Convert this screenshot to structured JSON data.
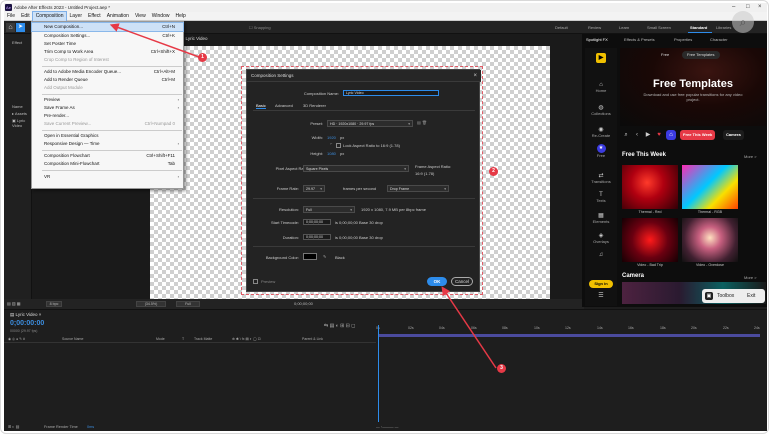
{
  "window": {
    "title": "Adobe After Effects 2023 - Untitled Project.aep *",
    "menus": [
      "File",
      "Edit",
      "Composition",
      "Layer",
      "Effect",
      "Animation",
      "View",
      "Window",
      "Help"
    ],
    "active_menu": "Composition"
  },
  "toolbar": {
    "snapping": "Snapping",
    "workspaces": [
      "Default",
      "Review",
      "Learn",
      "Small Screen",
      "Standard",
      "Libraries"
    ],
    "active_workspace": "Standard"
  },
  "composition_menu": {
    "items": [
      {
        "label": "New Composition...",
        "shortcut": "Ctrl+N",
        "state": "highlighted"
      },
      {
        "label": "Composition Settings...",
        "shortcut": "Ctrl+K"
      },
      {
        "label": "Set Poster Time",
        "shortcut": ""
      },
      {
        "label": "Trim Comp to Work Area",
        "shortcut": "Ctrl+Shift+X"
      },
      {
        "label": "Crop Comp to Region of Interest",
        "shortcut": "",
        "state": "disabled"
      },
      {
        "label": "Add to Adobe Media Encoder Queue...",
        "shortcut": "Ctrl+Alt+M"
      },
      {
        "label": "Add to Render Queue",
        "shortcut": "Ctrl+M"
      },
      {
        "label": "Add Output Module",
        "shortcut": "",
        "state": "disabled"
      },
      {
        "label": "Preview",
        "shortcut": "",
        "submenu": true
      },
      {
        "label": "Save Frame As",
        "shortcut": "",
        "submenu": true
      },
      {
        "label": "Pre-render...",
        "shortcut": ""
      },
      {
        "label": "Save Current Preview...",
        "shortcut": "Ctrl+Numpad 0",
        "state": "disabled"
      },
      {
        "label": "Open in Essential Graphics",
        "shortcut": ""
      },
      {
        "label": "Responsive Design — Time",
        "shortcut": "",
        "submenu": true
      },
      {
        "label": "Composition Flowchart",
        "shortcut": "Ctrl+Shift+F11"
      },
      {
        "label": "Composition Mini-Flowchart",
        "shortcut": "Tab"
      },
      {
        "label": "VR",
        "shortcut": "",
        "submenu": true
      }
    ]
  },
  "left_panel": {
    "tab": "Effect",
    "name_header": "Name",
    "items": [
      "Assets",
      "Lyric Video"
    ]
  },
  "viewer": {
    "tab": "Lyric Video",
    "zoom": "(34.5%)",
    "quality": "Full",
    "bits": "8 bpc",
    "timecode": "0;00;00;00"
  },
  "dialog": {
    "title": "Composition Settings",
    "name_label": "Composition Name:",
    "name_value": "Lyric Video",
    "tabs": [
      "Basic",
      "Advanced",
      "3D Renderer"
    ],
    "active_tab": "Basic",
    "preset_label": "Preset:",
    "preset_value": "HD · 1920x1080 · 29.97 fps",
    "width_label": "Width:",
    "width_value": "1920",
    "height_label": "Height:",
    "height_value": "1080",
    "px": "px",
    "lock_label": "Lock Aspect Ratio to 16:9 (1.78)",
    "pixel_aspect_label": "Pixel Aspect Ratio:",
    "pixel_aspect_value": "Square Pixels",
    "frame_aspect_label": "Frame Aspect Ratio:",
    "frame_aspect_value": "16:9 (1.78)",
    "frame_rate_label": "Frame Rate:",
    "frame_rate_value": "29.97",
    "fps_label": "frames per second",
    "drop_value": "Drop Frame",
    "resolution_label": "Resolution:",
    "resolution_value": "Full",
    "resolution_info": "1920 x 1080, 7.9 MB per 8bpc frame",
    "start_label": "Start Timecode:",
    "start_value": "0;00;00;00",
    "start_info": "is 0;00;00;00  Base 30   drop",
    "duration_label": "Duration:",
    "duration_value": "0;00;00;00",
    "duration_info": "is 0;00;00;00  Base 30   drop",
    "bg_label": "Background Color:",
    "bg_value": "Black",
    "preview_label": "Preview",
    "ok": "OK",
    "cancel": "Cancel"
  },
  "right_panel": {
    "tabs": [
      "Spotlight FX",
      "Effects & Presets",
      "Properties",
      "Character"
    ],
    "nav": [
      {
        "label": "Home",
        "icon": "home-icon"
      },
      {
        "label": "Collections",
        "icon": "collections-icon"
      },
      {
        "label": "Re-Create",
        "icon": "recreate-icon"
      },
      {
        "label": "Free",
        "icon": "star-icon",
        "selected": true
      },
      {
        "label": "Transitions",
        "icon": "transitions-icon"
      },
      {
        "label": "Texts",
        "icon": "texts-icon"
      },
      {
        "label": "Elements",
        "icon": "elements-icon"
      },
      {
        "label": "Overlays",
        "icon": "overlays-icon"
      },
      {
        "label": "",
        "icon": "music-icon"
      }
    ],
    "sign_in": "Sign in",
    "pills": [
      "Free",
      "Free Templates"
    ],
    "hero_title": "Free Templates",
    "hero_sub": "Download and use free popular transitions for any video project.",
    "chips": [
      "Free This Week",
      "Camera"
    ],
    "section1": "Free This Week",
    "section2": "Camera",
    "more": "More >",
    "thumbs": [
      "Thermal - Red",
      "Thermal - RGB",
      "Video - Bad Trip",
      "Video - Overdose"
    ],
    "toolbox": "Toolbox",
    "exit": "Exit"
  },
  "timeline": {
    "tab": "Lyric Video",
    "time": "0;00:00:00",
    "fps": "00000 (29.97 fps)",
    "columns": [
      "Source Name",
      "Mode",
      "T",
      "Track Matte",
      "Parent & Link"
    ],
    "ruler": [
      "0s",
      "02s",
      "04s",
      "06s",
      "08s",
      "10s",
      "12s",
      "14s",
      "16s",
      "18s",
      "20s",
      "22s",
      "24s"
    ],
    "footer_label": "Frame Render Time",
    "footer_value": "0ms"
  },
  "annotations": [
    "1",
    "2",
    "3"
  ]
}
